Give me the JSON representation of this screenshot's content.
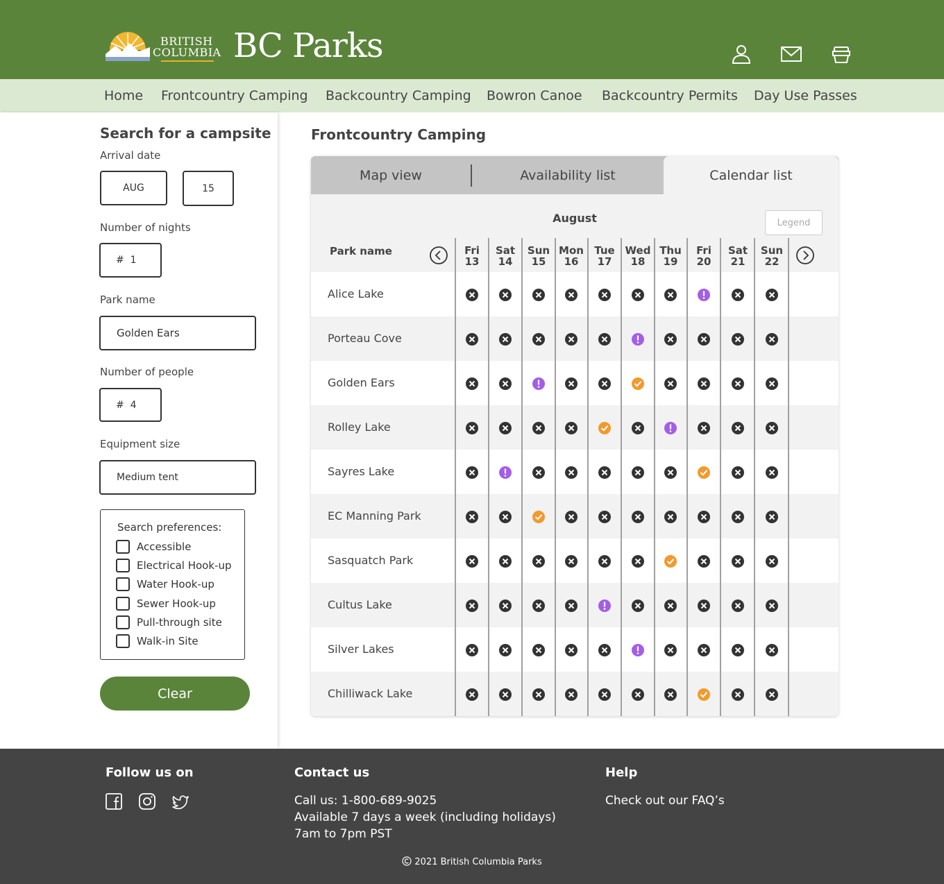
{
  "header": {
    "logo_line1": "BRITISH",
    "logo_line2": "COLUMBIA",
    "brand": "BC Parks",
    "icons": [
      "user-icon",
      "mail-icon",
      "cart-icon"
    ],
    "colors": {
      "primary_green": "#5b843b",
      "nav_bg": "#dce9d2",
      "footer_bg": "#444444"
    }
  },
  "nav": {
    "items": [
      "Home",
      "Frontcountry Camping",
      "Backcountry Camping",
      "Bowron Canoe",
      "Backcountry Permits",
      "Day Use Passes"
    ]
  },
  "sidebar": {
    "title": "Search for a campsite",
    "arrival_label": "Arrival date",
    "arrival_month": "AUG",
    "arrival_day": "15",
    "nights_label": "Number of nights",
    "nights_value": "#  1",
    "park_label": "Park name",
    "park_value": "Golden Ears",
    "people_label": "Number of people",
    "people_value": "#  4",
    "equipment_label": "Equipment size",
    "equipment_value": "Medium tent",
    "prefs_title": "Search preferences:",
    "prefs": [
      "Accessible",
      "Electrical Hook-up",
      "Water Hook-up",
      "Sewer Hook-up",
      "Pull-through site",
      "Walk-in Site"
    ],
    "clear_label": "Clear"
  },
  "main": {
    "title": "Frontcountry Camping",
    "tabs": [
      "Map view",
      "Availability list",
      "Calendar list"
    ],
    "active_tab": "Calendar list",
    "month": "August",
    "legend_label": "Legend",
    "park_header": "Park name",
    "days": [
      {
        "dow": "Fri",
        "date": "13"
      },
      {
        "dow": "Sat",
        "date": "14"
      },
      {
        "dow": "Sun",
        "date": "15"
      },
      {
        "dow": "Mon",
        "date": "16"
      },
      {
        "dow": "Tue",
        "date": "17"
      },
      {
        "dow": "Wed",
        "date": "18"
      },
      {
        "dow": "Thu",
        "date": "19"
      },
      {
        "dow": "Fri",
        "date": "20"
      },
      {
        "dow": "Sat",
        "date": "21"
      },
      {
        "dow": "Sun",
        "date": "22"
      }
    ],
    "status_colors": {
      "unavailable": "#333333",
      "limited": "#a45ee5",
      "available": "#f29a2e"
    },
    "parks": [
      {
        "name": "Alice Lake",
        "status": [
          "x",
          "x",
          "x",
          "x",
          "x",
          "x",
          "x",
          "!",
          "x",
          "x"
        ]
      },
      {
        "name": "Porteau Cove",
        "status": [
          "x",
          "x",
          "x",
          "x",
          "x",
          "!",
          "x",
          "x",
          "x",
          "x"
        ]
      },
      {
        "name": "Golden Ears",
        "status": [
          "x",
          "x",
          "!",
          "x",
          "x",
          "ok",
          "x",
          "x",
          "x",
          "x"
        ]
      },
      {
        "name": "Rolley Lake",
        "status": [
          "x",
          "x",
          "x",
          "x",
          "ok",
          "x",
          "!",
          "x",
          "x",
          "x"
        ]
      },
      {
        "name": "Sayres Lake",
        "status": [
          "x",
          "!",
          "x",
          "x",
          "x",
          "x",
          "x",
          "ok",
          "x",
          "x"
        ]
      },
      {
        "name": "EC Manning Park",
        "status": [
          "x",
          "x",
          "ok",
          "x",
          "x",
          "x",
          "x",
          "x",
          "x",
          "x"
        ]
      },
      {
        "name": "Sasquatch Park",
        "status": [
          "x",
          "x",
          "x",
          "x",
          "x",
          "x",
          "ok",
          "x",
          "x",
          "x"
        ]
      },
      {
        "name": "Cultus Lake",
        "status": [
          "x",
          "x",
          "x",
          "x",
          "!",
          "x",
          "x",
          "x",
          "x",
          "x"
        ]
      },
      {
        "name": "Silver Lakes",
        "status": [
          "x",
          "x",
          "x",
          "x",
          "x",
          "!",
          "x",
          "x",
          "x",
          "x"
        ]
      },
      {
        "name": "Chilliwack Lake",
        "status": [
          "x",
          "x",
          "x",
          "x",
          "x",
          "x",
          "x",
          "ok",
          "x",
          "x"
        ]
      }
    ]
  },
  "footer": {
    "follow_title": "Follow us on",
    "social_icons": [
      "facebook-icon",
      "instagram-icon",
      "twitter-icon"
    ],
    "contact_title": "Contact us",
    "contact_lines": [
      "Call us: 1-800-689-9025",
      "Available 7 days a week (including holidays)",
      "7am to 7pm PST"
    ],
    "help_title": "Help",
    "help_link": "Check out our FAQ’s",
    "copyright": "2021 British Columbia Parks"
  }
}
